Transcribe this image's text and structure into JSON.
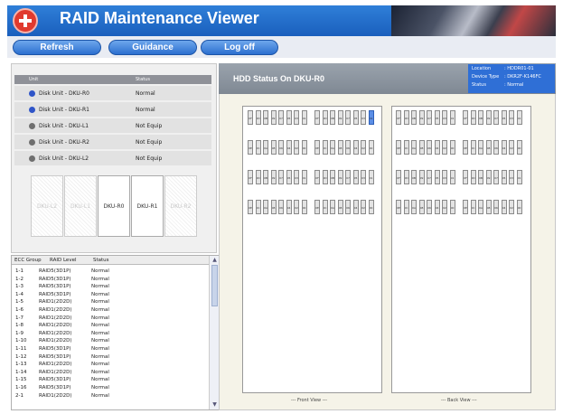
{
  "app": {
    "title": "RAID Maintenance Viewer"
  },
  "toolbar": {
    "refresh_label": "Refresh",
    "guidance_label": "Guidance",
    "logoff_label": "Log off"
  },
  "unit_table": {
    "col_unit": "Unit",
    "col_status": "Status",
    "rows": [
      {
        "name": "Disk Unit - DKU-R0",
        "status": "Normal",
        "icon_color": "#2f55c8"
      },
      {
        "name": "Disk Unit - DKU-R1",
        "status": "Normal",
        "icon_color": "#2f55c8"
      },
      {
        "name": "Disk Unit - DKU-L1",
        "status": "Not Equip",
        "icon_color": "#6f6f6f"
      },
      {
        "name": "Disk Unit - DKU-R2",
        "status": "Not Equip",
        "icon_color": "#6f6f6f"
      },
      {
        "name": "Disk Unit - DKU-L2",
        "status": "Not Equip",
        "icon_color": "#6f6f6f"
      }
    ]
  },
  "disk_boxes": [
    {
      "label": "DKU-L2",
      "equipped": false
    },
    {
      "label": "DKU-L1",
      "equipped": false
    },
    {
      "label": "DKU-R0",
      "equipped": true
    },
    {
      "label": "DKU-R1",
      "equipped": true
    },
    {
      "label": "DKU-R2",
      "equipped": false
    }
  ],
  "ecc_table": {
    "col_group": "ECC Group",
    "col_level": "RAID Level",
    "col_status": "Status",
    "rows": [
      {
        "group": "1-1",
        "level": "RAID5(3D1P)",
        "status": "Normal"
      },
      {
        "group": "1-2",
        "level": "RAID5(3D1P)",
        "status": "Normal"
      },
      {
        "group": "1-3",
        "level": "RAID5(3D1P)",
        "status": "Normal"
      },
      {
        "group": "1-4",
        "level": "RAID5(3D1P)",
        "status": "Normal"
      },
      {
        "group": "1-5",
        "level": "RAID1(2D2D)",
        "status": "Normal"
      },
      {
        "group": "1-6",
        "level": "RAID1(2D2D)",
        "status": "Normal"
      },
      {
        "group": "1-7",
        "level": "RAID1(2D2D)",
        "status": "Normal"
      },
      {
        "group": "1-8",
        "level": "RAID1(2D2D)",
        "status": "Normal"
      },
      {
        "group": "1-9",
        "level": "RAID1(2D2D)",
        "status": "Normal"
      },
      {
        "group": "1-10",
        "level": "RAID1(2D2D)",
        "status": "Normal"
      },
      {
        "group": "1-11",
        "level": "RAID5(3D1P)",
        "status": "Normal"
      },
      {
        "group": "1-12",
        "level": "RAID5(3D1P)",
        "status": "Normal"
      },
      {
        "group": "1-13",
        "level": "RAID1(2D2D)",
        "status": "Normal"
      },
      {
        "group": "1-14",
        "level": "RAID1(2D2D)",
        "status": "Normal"
      },
      {
        "group": "1-15",
        "level": "RAID5(3D1P)",
        "status": "Normal"
      },
      {
        "group": "1-16",
        "level": "RAID5(3D1P)",
        "status": "Normal"
      },
      {
        "group": "2-1",
        "level": "RAID1(2D2D)",
        "status": "Normal"
      }
    ]
  },
  "hdd_panel": {
    "title": "HDD Status On DKU-R0",
    "location_label": "Location",
    "location_value": ": HDDR01-01",
    "device_type_label": "Device Type",
    "device_type_value": ": DKR2F-K146FC",
    "status_label": "Status",
    "status_value": ": Normal",
    "front_view_label": "--- Front View ---",
    "back_view_label": "--- Back View ---",
    "row_labels_a": [
      "0F",
      "0D",
      "0B",
      "09",
      "07",
      "05",
      "03",
      "01"
    ],
    "row_labels_b": [
      "0E",
      "0C",
      "0A",
      "08",
      "06",
      "04",
      "02",
      "00"
    ]
  },
  "colors": {
    "accent": "#2f6fd6",
    "selected_slot": "#5b8ee6",
    "normal_disk": "#2f55c8",
    "not_equipped_disk": "#6f6f6f"
  }
}
